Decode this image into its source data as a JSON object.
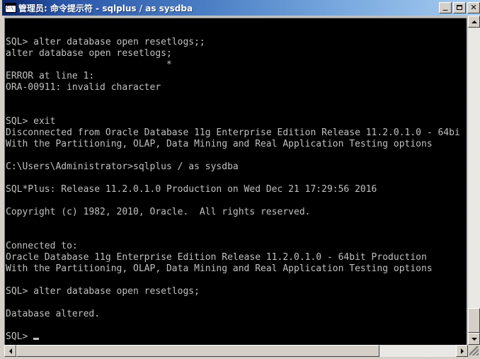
{
  "window": {
    "title": "管理员: 命令提示符 - sqlplus  / as sysdba",
    "icon": "console-icon",
    "buttons": {
      "minimize": "_",
      "maximize": "",
      "close": "✕"
    }
  },
  "console": {
    "background_color": "#000000",
    "text_color": "#c0c0c0",
    "lines": [
      "",
      "SQL> alter database open resetlogs;;",
      "alter database open resetlogs;",
      "                             *",
      "ERROR at line 1:",
      "ORA-00911: invalid character",
      "",
      "",
      "SQL> exit",
      "Disconnected from Oracle Database 11g Enterprise Edition Release 11.2.0.1.0 - 64bi",
      "With the Partitioning, OLAP, Data Mining and Real Application Testing options",
      "",
      "C:\\Users\\Administrator>sqlplus / as sysdba",
      "",
      "SQL*Plus: Release 11.2.0.1.0 Production on Wed Dec 21 17:29:56 2016",
      "",
      "Copyright (c) 1982, 2010, Oracle.  All rights reserved.",
      "",
      "",
      "Connected to:",
      "Oracle Database 11g Enterprise Edition Release 11.2.0.1.0 - 64bit Production",
      "With the Partitioning, OLAP, Data Mining and Real Application Testing options",
      "",
      "SQL> alter database open resetlogs;",
      "",
      "Database altered.",
      "",
      "SQL> "
    ],
    "prompt": "SQL>",
    "cursor_visible": true
  },
  "scrollbars": {
    "vertical": {
      "up_arrow": "▲",
      "down_arrow": "▼"
    },
    "horizontal": {
      "left_arrow": "◀",
      "right_arrow": "▶"
    }
  }
}
